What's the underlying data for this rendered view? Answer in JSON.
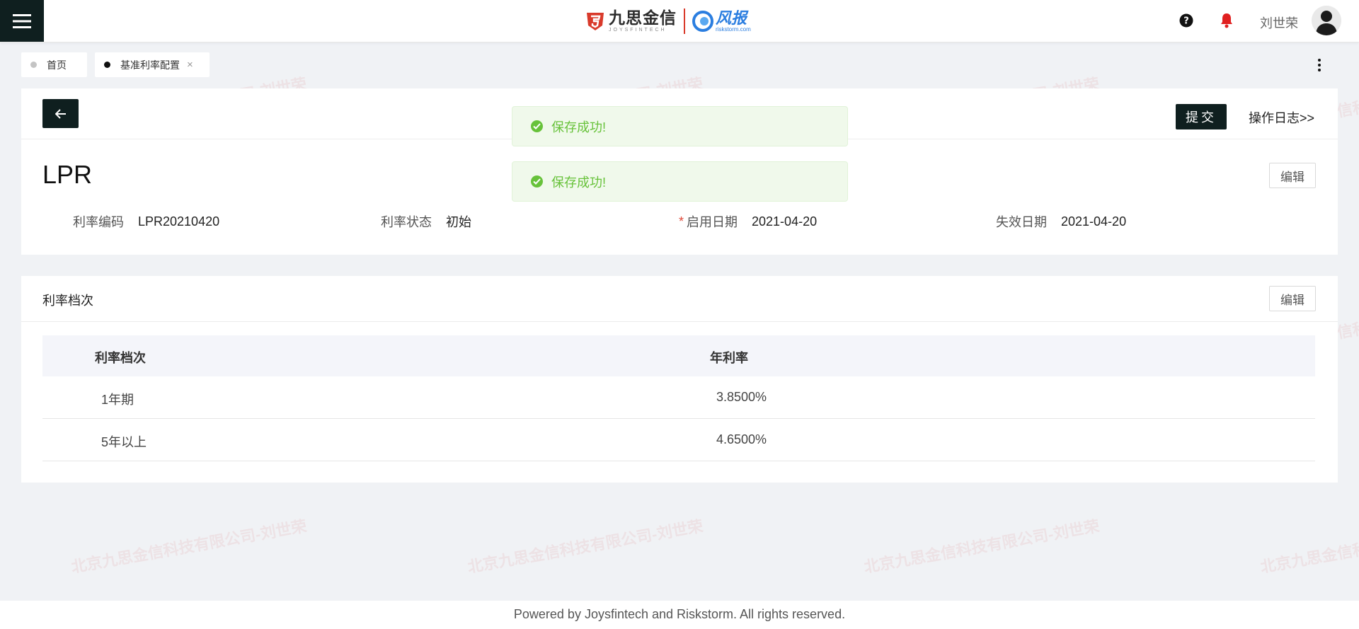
{
  "header": {
    "brand_cn": "九思金信",
    "brand_en": "JOYSFINTECH",
    "partner_cn": "风报",
    "partner_en": "riskstorm.com",
    "user_name": "刘世荣",
    "icons": [
      "menu-icon",
      "help-icon",
      "bell-icon",
      "avatar"
    ],
    "accent_dark": "#0f1f1f",
    "bell_color": "#e02020"
  },
  "tabs": [
    {
      "label": "首页",
      "active": false
    },
    {
      "label": "基准利率配置",
      "active": true,
      "close": "×"
    }
  ],
  "toolbar": {
    "submit_label": "提交",
    "log_label": "操作日志>>"
  },
  "toasts": [
    {
      "message": "保存成功!",
      "status_color": "#67c23a"
    },
    {
      "message": "保存成功!",
      "status_color": "#67c23a"
    }
  ],
  "detail": {
    "title": "LPR",
    "edit_label": "编辑",
    "fields": [
      {
        "label": "利率编码",
        "value": "LPR20210420",
        "required": false
      },
      {
        "label": "利率状态",
        "value": "初始",
        "required": false
      },
      {
        "label": "启用日期",
        "value": "2021-04-20",
        "required": true,
        "required_mark": "*"
      },
      {
        "label": "失效日期",
        "value": "2021-04-20",
        "required": false
      }
    ]
  },
  "tiers": {
    "section_title": "利率档次",
    "edit_label": "编辑",
    "columns": [
      "利率档次",
      "年利率"
    ],
    "rows": [
      {
        "tier": "1年期",
        "rate": "3.8500%"
      },
      {
        "tier": "5年以上",
        "rate": "4.6500%"
      }
    ]
  },
  "watermark": "北京九思金信科技有限公司-刘世荣",
  "footer": {
    "text": "Powered by Joysfintech and Riskstorm. All rights reserved."
  }
}
